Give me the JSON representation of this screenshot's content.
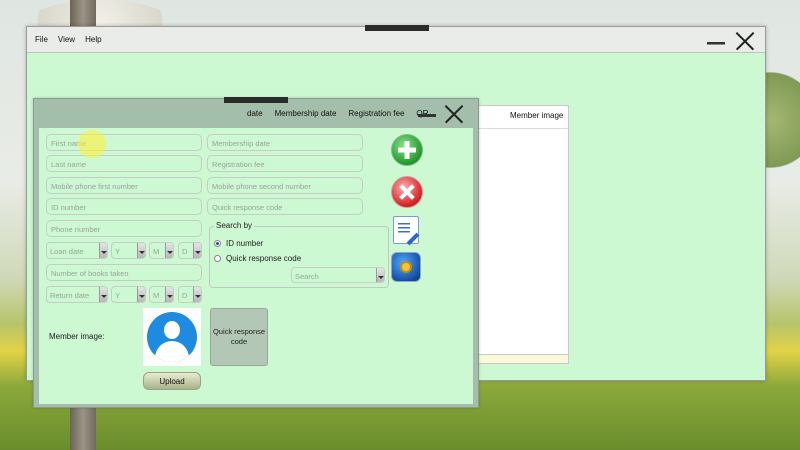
{
  "menu": [
    "File",
    "View",
    "Help"
  ],
  "table": {
    "columns": [
      "date",
      "Membership date",
      "Registration fee",
      "QR"
    ],
    "member_image_header": "Member image"
  },
  "form": {
    "left_fields": [
      "First name",
      "Last name",
      "Mobile phone first number",
      "ID number",
      "Phone number"
    ],
    "right_fields": [
      "Membership date",
      "Registration fee",
      "Mobile phone second number",
      "Quick response code"
    ],
    "loan": {
      "date": "Loan date",
      "y": "Y",
      "m": "M",
      "d": "D"
    },
    "books_taken": "Number of books taken",
    "return": {
      "date": "Return date",
      "y": "Y",
      "m": "M",
      "d": "D"
    },
    "search_by": {
      "title": "Search by",
      "options": [
        "ID number",
        "Quick response code"
      ],
      "selected": "ID number",
      "search_placeholder": "Search"
    },
    "member_image_label": "Member image:",
    "upload_label": "Upload",
    "qr_label": "Quick response code"
  },
  "actions": {
    "add_icon": "add-icon",
    "delete_icon": "delete-icon",
    "edit_icon": "edit-icon",
    "search_icon": "search-icon"
  },
  "colors": {
    "panel": "#ccf8d2",
    "dialog_header": "#a3beab",
    "avatar": "#1e8be0"
  }
}
